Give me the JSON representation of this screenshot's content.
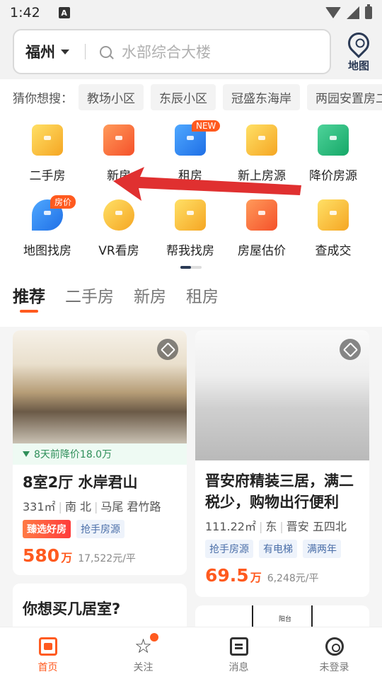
{
  "status": {
    "time": "1:42",
    "notification_letter": "A"
  },
  "search": {
    "city": "福州",
    "placeholder": "水部综合大楼",
    "map_label": "地图"
  },
  "guess": {
    "label": "猜你想搜：",
    "items": [
      "教场小区",
      "东辰小区",
      "冠盛东海岸",
      "两园安置房二"
    ]
  },
  "grid": [
    {
      "label": "二手房",
      "icon": "secondhand-home-icon",
      "color": "yellow"
    },
    {
      "label": "新房",
      "icon": "new-home-icon",
      "color": "orange"
    },
    {
      "label": "租房",
      "icon": "rent-icon",
      "color": "blue",
      "badge": "NEW"
    },
    {
      "label": "新上房源",
      "icon": "new-listing-icon",
      "color": "yellow"
    },
    {
      "label": "降价房源",
      "icon": "price-drop-icon",
      "color": "green"
    },
    {
      "label": "地图找房",
      "icon": "map-search-icon",
      "color": "blue",
      "badge": "房价"
    },
    {
      "label": "VR看房",
      "icon": "vr-view-icon",
      "color": "yellow"
    },
    {
      "label": "帮我找房",
      "icon": "help-find-icon",
      "color": "yellow"
    },
    {
      "label": "房屋估价",
      "icon": "valuation-icon",
      "color": "orange"
    },
    {
      "label": "查成交",
      "icon": "deal-hammer-icon",
      "color": "yellow"
    }
  ],
  "tabs": [
    "推荐",
    "二手房",
    "新房",
    "租房"
  ],
  "listings": [
    {
      "price_drop": "8天前降价18.0万",
      "title": "8室2厅 水岸君山",
      "area": "331㎡",
      "orientation": "南 北",
      "location": "马尾 君竹路",
      "tags": [
        "臻选好房",
        "抢手房源"
      ],
      "price": "580",
      "price_unit": "万",
      "unit_price": "17,522元/平"
    },
    {
      "title": "晋安府精装三居，满二税少，购物出行便利",
      "area": "111.22㎡",
      "orientation": "东",
      "location": "晋安 五四北",
      "tags": [
        "抢手房源",
        "有电梯",
        "满两年"
      ],
      "price": "69.5",
      "price_unit": "万",
      "unit_price": "6,248元/平"
    }
  ],
  "question_card": {
    "title": "你想买几居室?"
  },
  "floorplan_label": "阳台",
  "bottom_nav": [
    {
      "label": "首页",
      "icon": "home-icon",
      "active": true
    },
    {
      "label": "关注",
      "icon": "star-icon",
      "active": false
    },
    {
      "label": "消息",
      "icon": "message-icon",
      "active": false
    },
    {
      "label": "未登录",
      "icon": "user-icon",
      "active": false
    }
  ],
  "colors": {
    "accent": "#ff5a1f",
    "nav_dark": "#2b3a55",
    "arrow_red": "#e03030",
    "price_drop_green": "#2f8f5a"
  }
}
